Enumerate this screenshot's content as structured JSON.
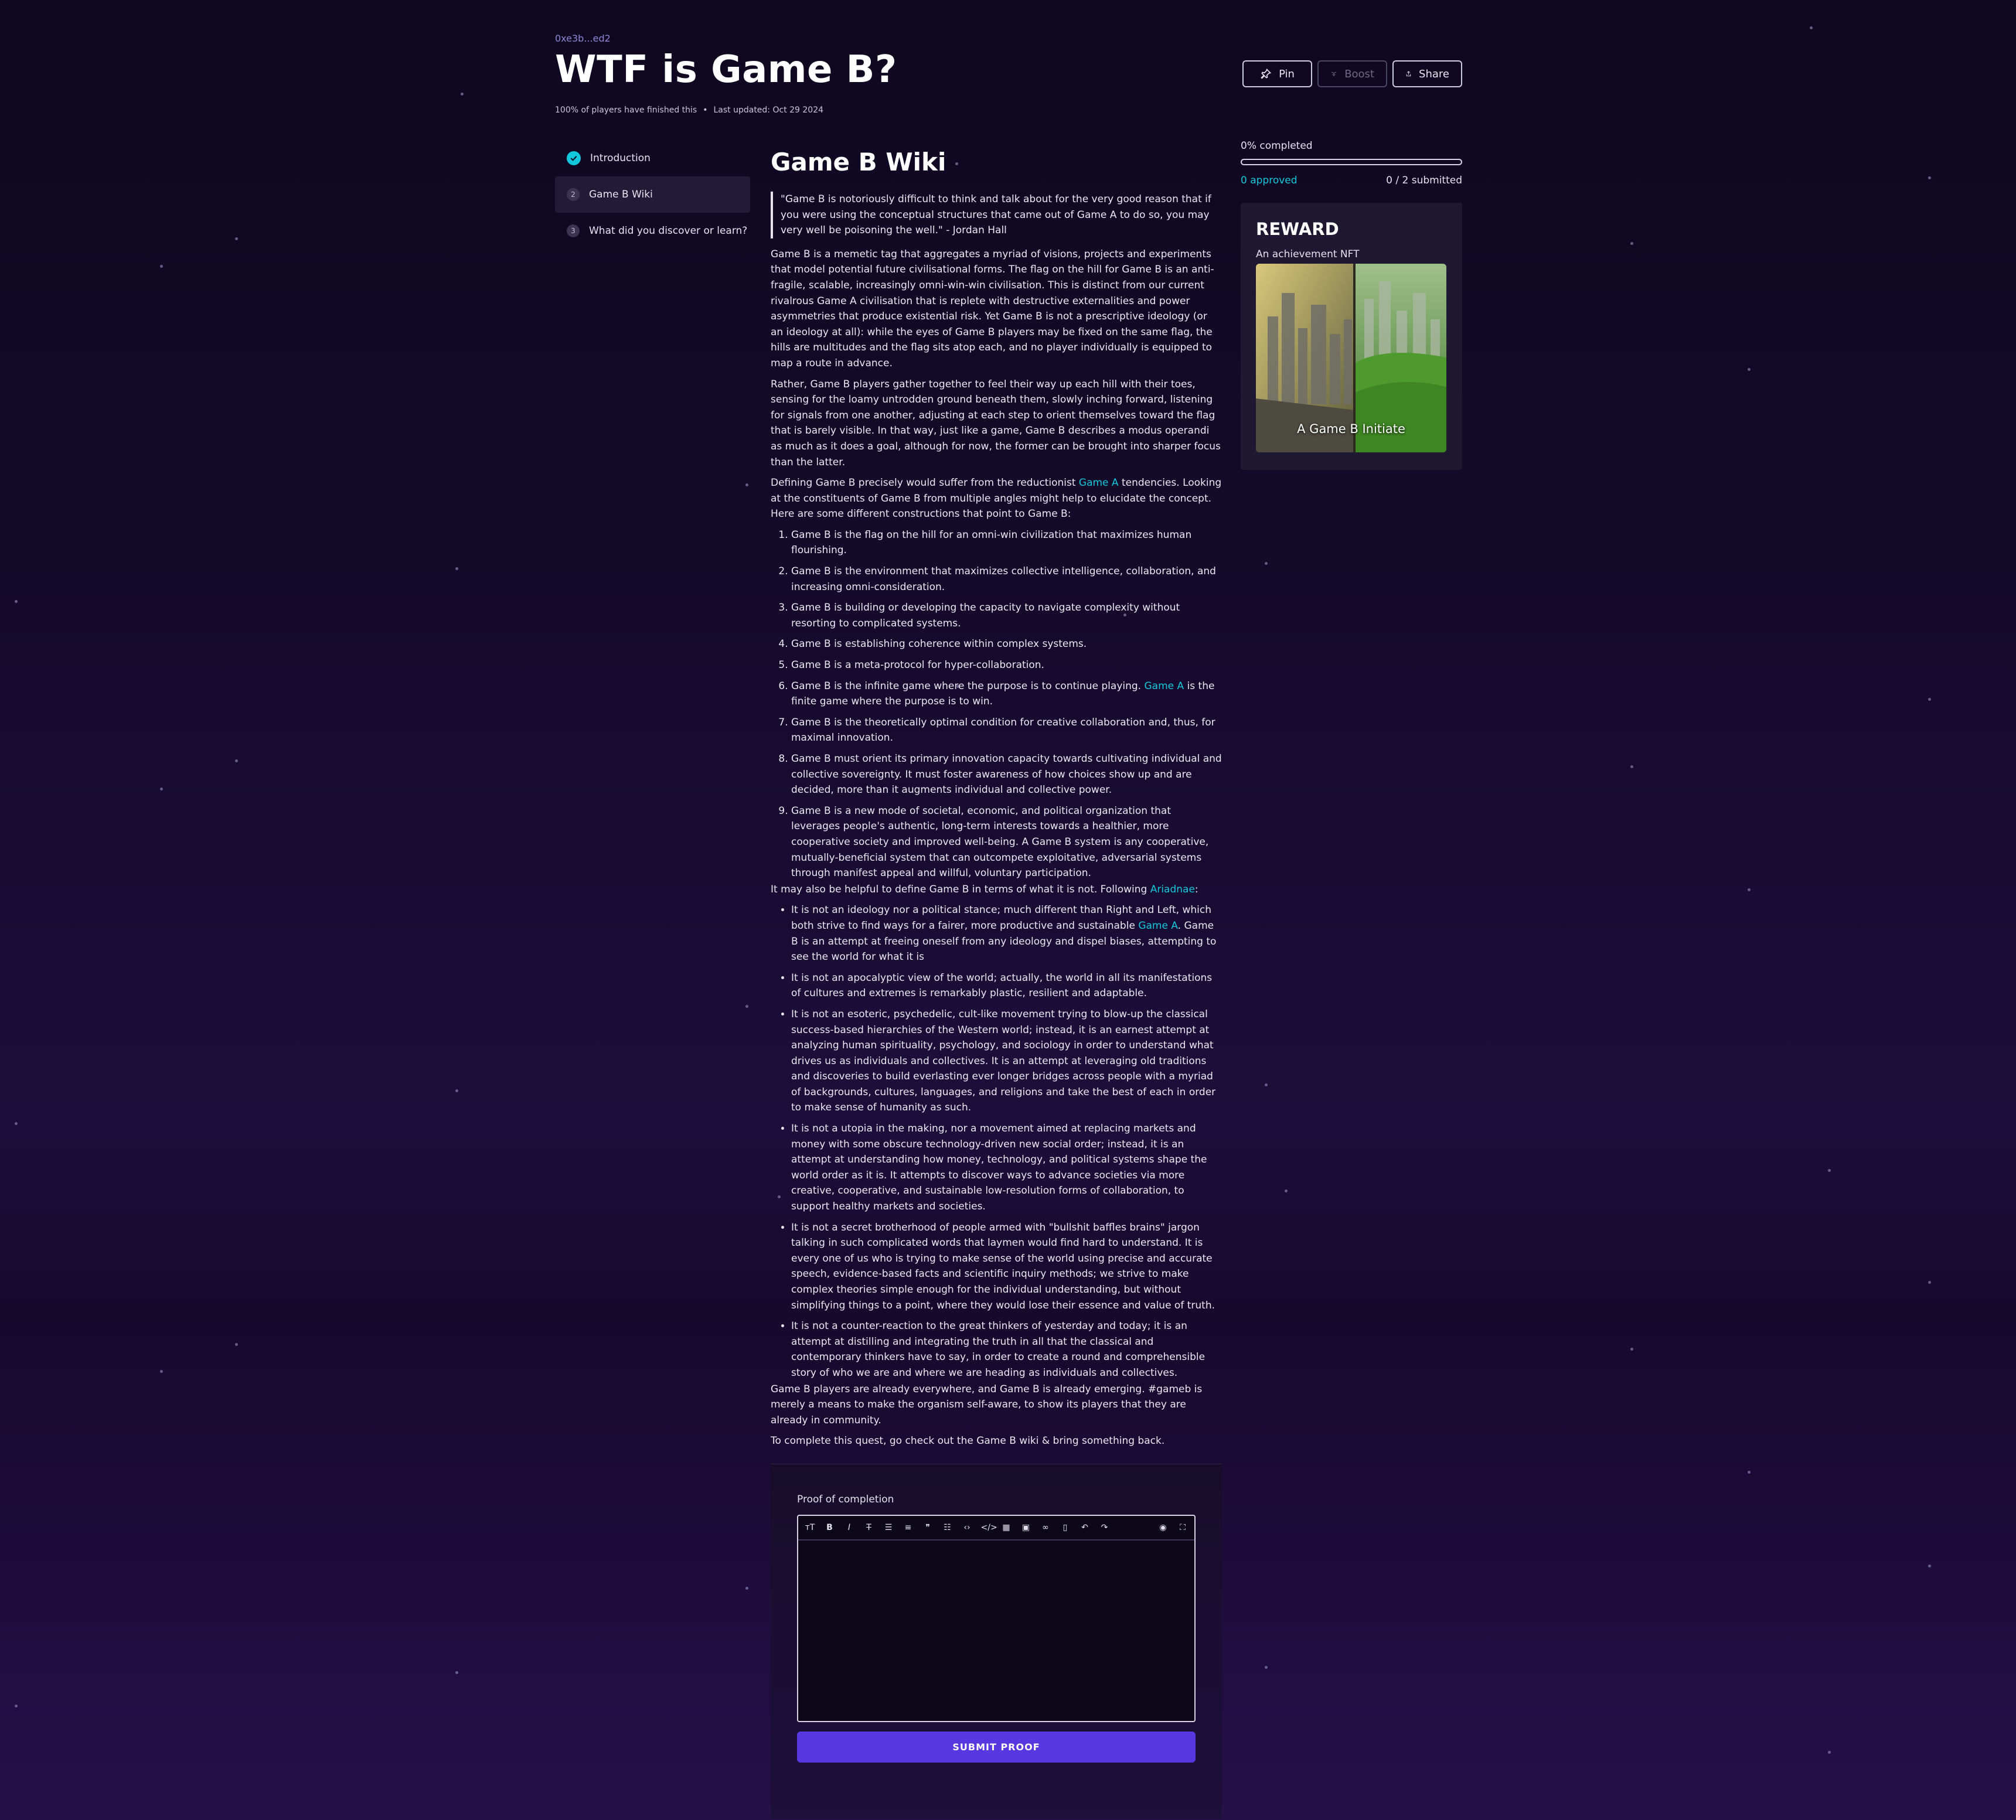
{
  "quest": {
    "address": "0xe3b...ed2",
    "title": "WTF is Game B?",
    "finished": "100% of players have finished this",
    "updated": "Last updated: Oct 29 2024"
  },
  "actions": {
    "pin": "Pin",
    "boost": "Boost",
    "share": "Share"
  },
  "steps": [
    {
      "num": "1",
      "label": "Introduction"
    },
    {
      "num": "2",
      "label": "Game B Wiki"
    },
    {
      "num": "3",
      "label": "What did you discover or learn?"
    }
  ],
  "progress": {
    "completed": "0% completed",
    "fraction": 0,
    "approved": "0 approved",
    "submitted": "0 / 2 submitted"
  },
  "reward": {
    "heading": "REWARD",
    "subtitle": "An achievement NFT",
    "nft_label": "A Game B Initiate"
  },
  "article": {
    "title": "Game B Wiki",
    "quote": "\"Game B is notoriously difficult to think and talk about for the very good reason that if you were using the conceptual structures that came out of Game A to do so, you may very well be poisoning the well.\" - Jordan Hall",
    "p1": "Game B is a memetic tag that aggregates a myriad of visions, projects and experiments that model potential future civilisational forms. The flag on the hill for Game B is an anti-fragile, scalable, increasingly omni-win-win civilisation. This is distinct from our current rivalrous Game A civilisation that is replete with destructive externalities and power asymmetries that produce existential risk. Yet Game B is not a prescriptive ideology (or an ideology at all): while the eyes of Game B players may be fixed on the same flag, the hills are multitudes and the flag sits atop each, and no player individually is equipped to map a route in advance.",
    "p2": "Rather, Game B players gather together to feel their way up each hill with their toes, sensing for the loamy untrodden ground beneath them, slowly inching forward, listening for signals from one another, adjusting at each step to orient themselves toward the flag that is barely visible. In that way, just like a game, Game B describes a modus operandi as much as it does a goal, although for now, the former can be brought into sharper focus than the latter.",
    "p3_a": "Defining Game B precisely would suffer from the reductionist ",
    "p3_link": "Game A",
    "p3_b": " tendencies. Looking at the constituents of Game B from multiple angles might help to elucidate the concept. Here are some different constructions that point to Game B:",
    "list": [
      "Game B is the flag on the hill for an omni-win civilization that maximizes human flourishing.",
      "Game B is the environment that maximizes collective intelligence, collaboration, and increasing omni-consideration.",
      "Game B is building or developing the capacity to navigate complexity without resorting to complicated systems.",
      "Game B is establishing coherence within complex systems.",
      "Game B is a meta-protocol for hyper-collaboration.",
      "Game B is the infinite game where the purpose is to continue playing.",
      "Game B is the theoretically optimal condition for creative collaboration and, thus, for maximal innovation.",
      "Game B must orient its primary innovation capacity towards cultivating individual and collective sovereignty. It must foster awareness of how choices show up and are decided, more than it augments individual and collective power.",
      "Game B is a new mode of societal, economic, and political organization that leverages people's authentic, long-term interests towards a healthier, more cooperative society and improved well-being. A Game B system is any cooperative, mutually-beneficial system that can outcompete exploitative, adversarial systems through manifest appeal and willful, voluntary participation."
    ],
    "list6_link": "Game A",
    "list6_tail": " is the finite game where the purpose is to win.",
    "p4_a": "It may also be helpful to define Game B in terms of what it is not. Following ",
    "p4_link": "Ariadnae",
    "p4_b": ":",
    "bullets": [
      "It is not an ideology nor a political stance; much different than Right and Left, which both strive to find ways for a fairer, more productive and sustainable ",
      "It is not an apocalyptic view of the world; actually, the world in all its manifestations of cultures and extremes is remarkably plastic, resilient and adaptable.",
      "It is not an esoteric, psychedelic, cult-like movement trying to blow-up the classical success-based hierarchies of the Western world; instead, it is an earnest attempt at analyzing human spirituality, psychology, and sociology in order to understand what drives us as individuals and collectives. It is an attempt at leveraging old traditions and discoveries to build everlasting ever longer bridges across people with a myriad of backgrounds, cultures, languages, and religions and take the best of each in order to make sense of humanity as such.",
      "It is not a utopia in the making, nor a movement aimed at replacing markets and money with some obscure technology-driven new social order; instead, it is an attempt at understanding how money, technology, and political systems shape the world order as it is. It attempts to discover ways to advance societies via more creative, cooperative, and sustainable low-resolution forms of collaboration, to support healthy markets and societies.",
      "It is not a secret brotherhood of people armed with \"bullshit baffles brains\" jargon talking in such complicated words that laymen would find hard to understand. It is every one of us who is trying to make sense of the world using precise and accurate speech, evidence-based facts and scientific inquiry methods; we strive to make complex theories simple enough for the individual understanding, but without simplifying things to a point, where they would lose their essence and value of truth.",
      "It is not a counter-reaction to the great thinkers of yesterday and today; it is an attempt at distilling and integrating the truth in all that the classical and contemporary thinkers have to say, in order to create a round and comprehensible story of who we are and where we are heading as individuals and collectives."
    ],
    "bullet1_link": "Game A",
    "bullet1_tail": ". Game B is an attempt at freeing oneself from any ideology and dispel biases, attempting to see the world for what it is",
    "p5": "Game B players are already everywhere, and Game B is already emerging. #gameb is merely a means to make the organism self-aware, to show its players that they are already in community.",
    "p6": "To complete this quest, go check out the Game B wiki & bring something back."
  },
  "proof": {
    "label": "Proof of completion",
    "toolbar": [
      "heading-icon",
      "bold-icon",
      "italic-icon",
      "strikethrough-icon",
      "bullet-list-icon",
      "numbered-list-icon",
      "quote-icon",
      "checklist-icon",
      "code-icon",
      "code-block-icon",
      "table-icon",
      "image-icon",
      "link-icon",
      "clear-icon",
      "undo-icon",
      "redo-icon",
      "preview-icon",
      "fullscreen-icon"
    ],
    "submit": "SUBMIT PROOF"
  },
  "colors": {
    "accent": "#16c8dc",
    "primary_button": "#5638e0",
    "background": "#140a2a"
  }
}
